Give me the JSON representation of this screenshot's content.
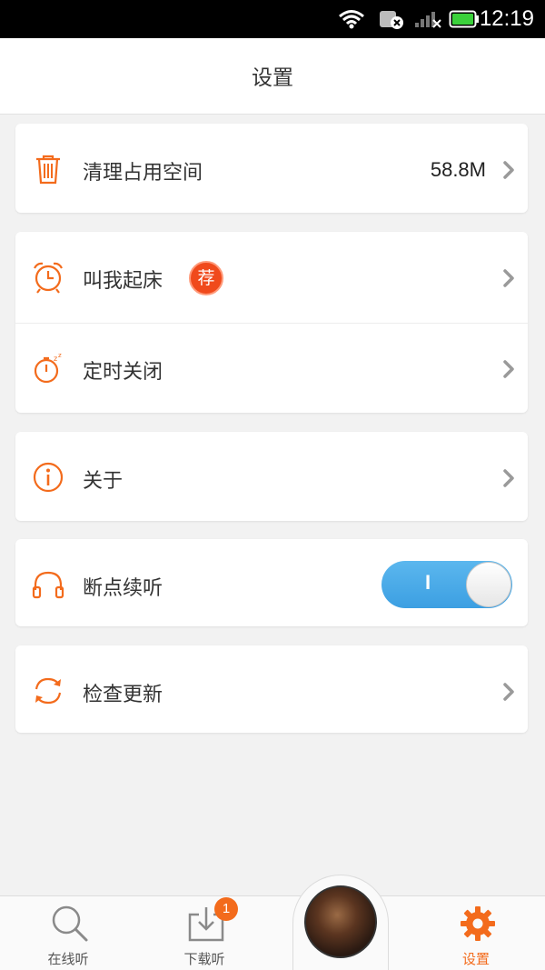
{
  "status_bar": {
    "time": "12:19"
  },
  "header": {
    "title": "设置"
  },
  "settings": {
    "clear_space": {
      "label": "清理占用空间",
      "value": "58.8M"
    },
    "wake_me": {
      "label": "叫我起床",
      "badge": "荐"
    },
    "timer_off": {
      "label": "定时关闭"
    },
    "about": {
      "label": "关于"
    },
    "resume_play": {
      "label": "断点续听",
      "toggle_on": true,
      "toggle_mark": "I"
    },
    "check_update": {
      "label": "检查更新"
    }
  },
  "tabs": {
    "online": {
      "label": "在线听",
      "icon": "search-icon"
    },
    "download": {
      "label": "下载听",
      "icon": "download-icon",
      "badge": "1"
    },
    "settings": {
      "label": "设置",
      "icon": "gear-icon",
      "active": true
    }
  },
  "colors": {
    "accent": "#f36b1c",
    "toggle_on": "#4aa9e8",
    "badge_red": "#f04a1c"
  }
}
